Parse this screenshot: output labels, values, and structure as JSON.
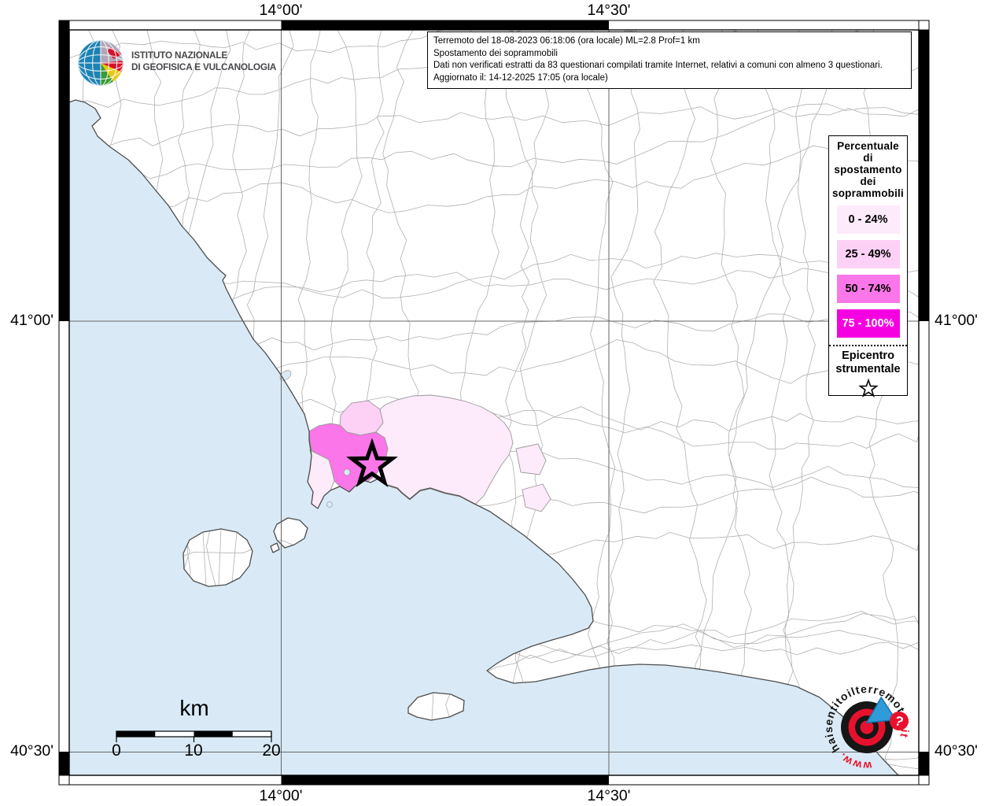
{
  "info_box": {
    "line1": "Terremoto del 18-08-2023 06:18:06 (ora locale) ML=2.8 Prof=1 km",
    "line2": "Spostamento dei soprammobili",
    "line3": "Dati non verificati estratti da 83 questionari compilati tramite Internet, relativi a comuni con almeno 3 questionari.",
    "line4": "Aggiornato il: 14-12-2025 17:05 (ora locale)"
  },
  "ingv_logo": {
    "line1": "ISTITUTO NAZIONALE",
    "line2": "DI GEOFISICA E VULCANOLOGIA"
  },
  "legend": {
    "title_lines": [
      "Percentuale",
      "di",
      "spostamento",
      "dei",
      "soprammobili"
    ],
    "classes": [
      {
        "label": "0 - 24%",
        "color": "#fdeafa",
        "text_color": "#000000"
      },
      {
        "label": "25 - 49%",
        "color": "#fdd0f5",
        "text_color": "#000000"
      },
      {
        "label": "50 - 74%",
        "color": "#fb76e8",
        "text_color": "#000000"
      },
      {
        "label": "75 - 100%",
        "color": "#f500e1",
        "text_color": "#ffffff"
      }
    ],
    "epicenter_line1": "Epicentro",
    "epicenter_line2": "strumentale"
  },
  "grid": {
    "lon_labels": [
      "14°00'",
      "14°30'"
    ],
    "lat_labels": [
      "41°00'",
      "40°30'"
    ]
  },
  "scale_bar": {
    "title": "km",
    "ticks": [
      "0",
      "10",
      "20"
    ]
  },
  "watermark": {
    "prefix": "www.",
    "main": "haisentitoilterremoto",
    "tld": ".it",
    "badge": "?"
  },
  "map_colors": {
    "sea": "#d9eaf6",
    "land": "#ffffff",
    "municipality_border": "#b0b0b0",
    "coastline": "#4d4d4d",
    "gridline": "#666666",
    "epicenter_star": "#000000"
  }
}
